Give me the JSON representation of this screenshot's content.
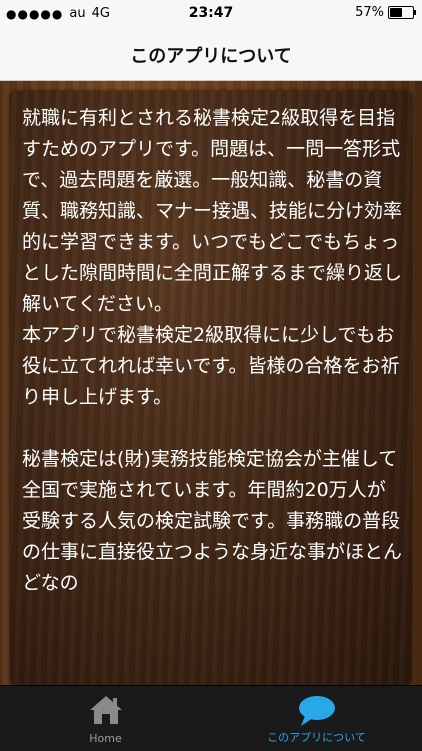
{
  "status_bar": {
    "carrier": "au",
    "network": "4G",
    "time": "23:47",
    "battery": "57%",
    "battery_level": 0.57
  },
  "nav": {
    "title": "このアプリについて"
  },
  "content": {
    "text": "就職に有利とされる秘書検定2級取得を目指すためのアプリです。問題は、一問一答形式で、過去問題を厳選。一般知識、秘書の資質、職務知識、マナー接遇、技能に分け効率的に学習できます。いつでもどこでもちょっとした隙間時間に全問正解するまで繰り返し解いてください。\n本アプリで秘書検定2級取得にに少しでもお役に立てれれば幸いです。皆様の合格をお祈り申し上げます。\n\n秘書検定は(財)実務技能検定協会が主催して全国で実施されています。年間約20万人が受験する人気の検定試験です。事務職の普段の仕事に直接役立つような身近な事がほとんどなの"
  },
  "tabs": [
    {
      "label": "Home",
      "icon": "house-icon",
      "selected": false
    },
    {
      "label": "このアプリについて",
      "icon": "speech-bubble-icon",
      "selected": true
    }
  ],
  "colors": {
    "tab_selected": "#2aa7e6",
    "tab_unselected": "#9a9a9a",
    "text": "#ffffff"
  }
}
